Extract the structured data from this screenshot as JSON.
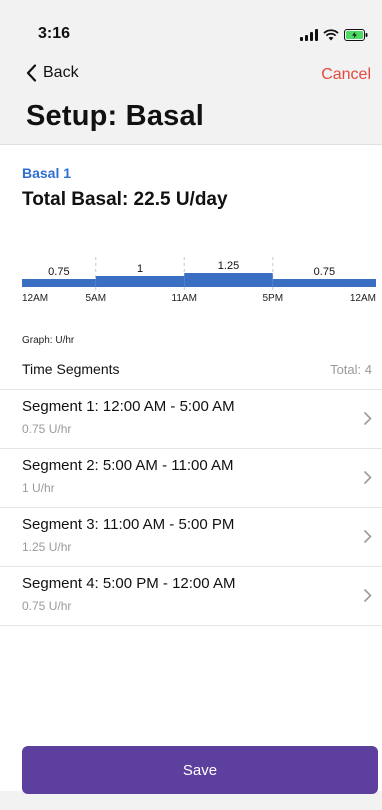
{
  "status_bar": {
    "time": "3:16"
  },
  "nav": {
    "back_label": "Back",
    "cancel_label": "Cancel"
  },
  "page": {
    "title": "Setup: Basal"
  },
  "basal": {
    "name": "Basal 1",
    "total_label": "Total Basal: 22.5 U/day"
  },
  "chart_data": {
    "type": "bar",
    "unit_label": "Graph: U/hr",
    "x_ticks": [
      "12AM",
      "5AM",
      "11AM",
      "5PM",
      "12AM"
    ],
    "segments": [
      {
        "start_hour": 0,
        "end_hour": 5,
        "value": 0.75,
        "label": "0.75"
      },
      {
        "start_hour": 5,
        "end_hour": 11,
        "value": 1,
        "label": "1"
      },
      {
        "start_hour": 11,
        "end_hour": 17,
        "value": 1.25,
        "label": "1.25"
      },
      {
        "start_hour": 17,
        "end_hour": 24,
        "value": 0.75,
        "label": "0.75"
      }
    ],
    "color": "#3a6fc4"
  },
  "segments_section": {
    "title": "Time Segments",
    "total": "Total: 4"
  },
  "segments": [
    {
      "title": "Segment 1: 12:00 AM - 5:00 AM",
      "rate": "0.75 U/hr"
    },
    {
      "title": "Segment 2: 5:00 AM - 11:00 AM",
      "rate": "1 U/hr"
    },
    {
      "title": "Segment 3: 11:00 AM - 5:00 PM",
      "rate": "1.25 U/hr"
    },
    {
      "title": "Segment 4: 5:00 PM - 12:00 AM",
      "rate": "0.75 U/hr"
    }
  ],
  "save_label": "Save",
  "colors": {
    "accent_blue": "#2f6fd0",
    "cancel_red": "#e5483f",
    "save_purple": "#5d3f9e"
  }
}
